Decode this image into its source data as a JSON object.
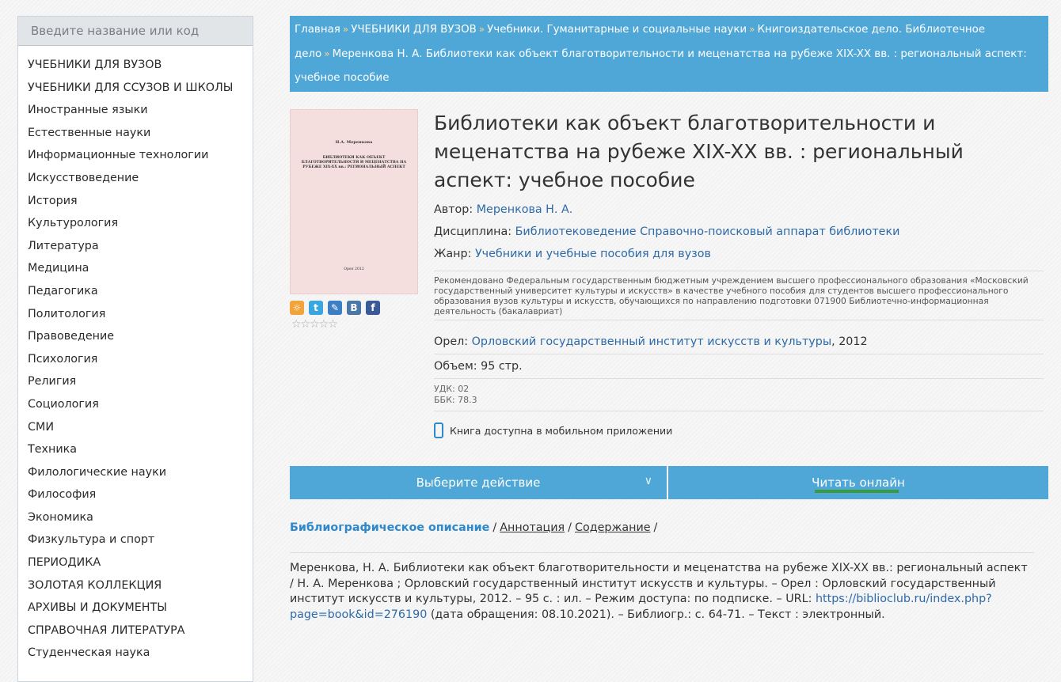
{
  "search": {
    "placeholder": "Введите название или код"
  },
  "sidebar": {
    "items": [
      "УЧЕБНИКИ ДЛЯ ВУЗОВ",
      "УЧЕБНИКИ ДЛЯ ССУЗОВ И ШКОЛЫ",
      "Иностранные языки",
      "Естественные науки",
      "Информационные технологии",
      "Искусствоведение",
      "История",
      "Культурология",
      "Литература",
      "Медицина",
      "Педагогика",
      "Политология",
      "Правоведение",
      "Психология",
      "Религия",
      "Социология",
      "СМИ",
      "Техника",
      "Филологические науки",
      "Философия",
      "Экономика",
      "Физкультура и спорт",
      "ПЕРИОДИКА",
      "ЗОЛОТАЯ КОЛЛЕКЦИЯ",
      "АРХИВЫ И ДОКУМЕНТЫ",
      "СПРАВОЧНАЯ ЛИТЕРАТУРА",
      "Студенческая наука"
    ]
  },
  "breadcrumb": {
    "items": [
      "Главная",
      "УЧЕБНИКИ ДЛЯ ВУЗОВ",
      "Учебники. Гуманитарные и социальные науки",
      "Книгоиздательское дело. Библиотечное дело",
      "Меренкова Н. А. Библиотеки как объект благотворительности и меценатства на рубеже XIX-XX вв. : региональный аспект: учебное пособие"
    ],
    "separator": "»"
  },
  "cover": {
    "author": "Н.А. Меренкова",
    "title": "БИБЛИОТЕКИ КАК ОБЪЕКТ БЛАГОТВОРИТЕЛЬНОСТИ И МЕЦЕНАТСТВА НА РУБЕЖЕ XIX-XX вв.: РЕГИОНАЛЬНЫЙ АСПЕКТ",
    "bottom": "Орел 2012"
  },
  "share": {
    "icons": [
      "vk-like-icon",
      "twitter-icon",
      "livejournal-icon",
      "vkontakte-icon",
      "facebook-icon"
    ],
    "labels": [
      "☼",
      "t",
      "✎",
      "B",
      "f"
    ],
    "colors": [
      "#f2a33a",
      "#3aa6e0",
      "#3d7fc4",
      "#4a76a8",
      "#3b5998"
    ]
  },
  "rating": {
    "stars": "☆☆☆☆☆"
  },
  "book": {
    "title": "Библиотеки как объект благотворительности и меценатства на рубеже XIX-XX вв. : региональный аспект: учебное пособие",
    "author_label": "Автор: ",
    "author": "Меренкова Н. А.",
    "discipline_label": "Дисциплина: ",
    "discipline": "Библиотековедение Справочно-поисковый аппарат библиотеки",
    "genre_label": "Жанр: ",
    "genre": "Учебники и учебные пособия для вузов",
    "recommendation": "Рекомендовано Федеральным государственным бюджетным учреждением высшего профессионального образования «Московский государственный университет культуры и искусств» в качестве учебного пособия для студентов высшего профессионального образования вузов культуры и искусств, обучающихся по направлению подготовки 071900 Библиотечно-информационная деятельность (бакалавриат)",
    "city": "Орел: ",
    "publisher": "Орловский государственный институт искусств и культуры",
    "year": ", 2012",
    "volume": "Объем: 95 стр.",
    "udk": "УДК: 02",
    "bbk": "ББК: 78.3",
    "mobile": "Книга доступна в мобильном приложении"
  },
  "actions": {
    "select_label": "Выберите действие",
    "chevron": "∨",
    "read_label": "Читать онлайн"
  },
  "tabs": {
    "biblio": "Библиографическое описание",
    "annotation": "Аннотация",
    "contents": "Содержание",
    "slash": "/"
  },
  "biblio": {
    "text_before": "Меренкова, Н. А. Библиотеки как объект благотворительности и меценатства на рубеже XIX-XX вв.: региональный аспект / Н. А. Меренкова ; Орловский государственный институт искусств и культуры. – Орел : Орловский государственный институт искусств и культуры, 2012. – 95 с. : ил. – Режим доступа: по подписке. – URL: ",
    "url": "https://biblioclub.ru/index.php?page=book&id=276190",
    "text_after": " (дата обращения: 08.10.2021). – Библиогр.: с. 64-71. – Текст : электронный."
  }
}
